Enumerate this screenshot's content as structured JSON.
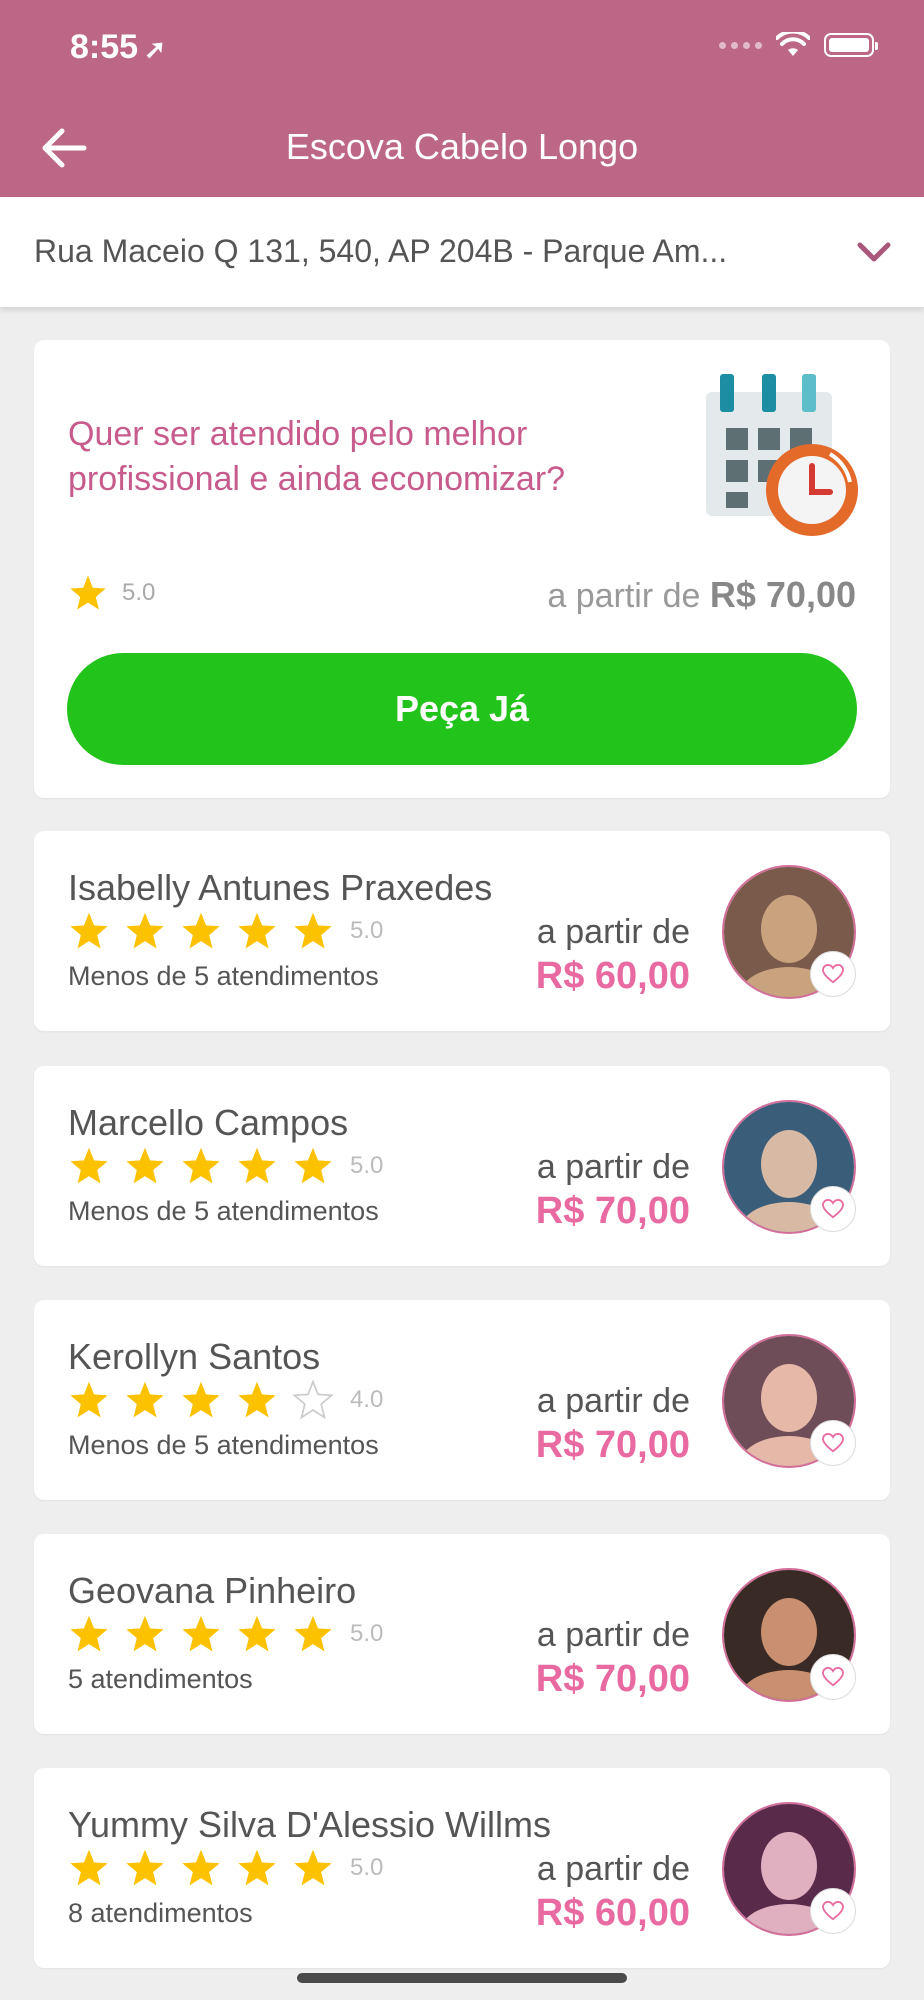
{
  "status_bar": {
    "time": "8:55"
  },
  "header": {
    "title": "Escova Cabelo Longo"
  },
  "address": {
    "text": "Rua Maceio Q 131, 540, AP 204B - Parque Am..."
  },
  "promo": {
    "text": "Quer ser atendido pelo melhor profissional e ainda economizar?",
    "rating": "5.0",
    "price_prefix": "a partir de",
    "price": "R$ 70,00",
    "button_label": "Peça Já"
  },
  "colors": {
    "brand": "#bd6786",
    "accent_text": "#e86aa0",
    "cta": "#22c31a",
    "star": "#fcc200"
  },
  "professionals": [
    {
      "name": "Isabelly Antunes Praxedes",
      "stars": 5,
      "rating": "5.0",
      "appointments": "Menos de 5 atendimentos",
      "price_prefix": "a partir de",
      "price": "R$ 60,00"
    },
    {
      "name": "Marcello Campos",
      "stars": 5,
      "rating": "5.0",
      "appointments": "Menos de 5 atendimentos",
      "price_prefix": "a partir de",
      "price": "R$ 70,00"
    },
    {
      "name": "Kerollyn Santos",
      "stars": 4,
      "rating": "4.0",
      "appointments": "Menos de 5 atendimentos",
      "price_prefix": "a partir de",
      "price": "R$ 70,00"
    },
    {
      "name": "Geovana Pinheiro",
      "stars": 5,
      "rating": "5.0",
      "appointments": "5 atendimentos",
      "price_prefix": "a partir de",
      "price": "R$ 70,00"
    },
    {
      "name": "Yummy Silva D'Alessio Willms",
      "stars": 5,
      "rating": "5.0",
      "appointments": "8 atendimentos",
      "price_prefix": "a partir de",
      "price": "R$ 60,00"
    }
  ]
}
